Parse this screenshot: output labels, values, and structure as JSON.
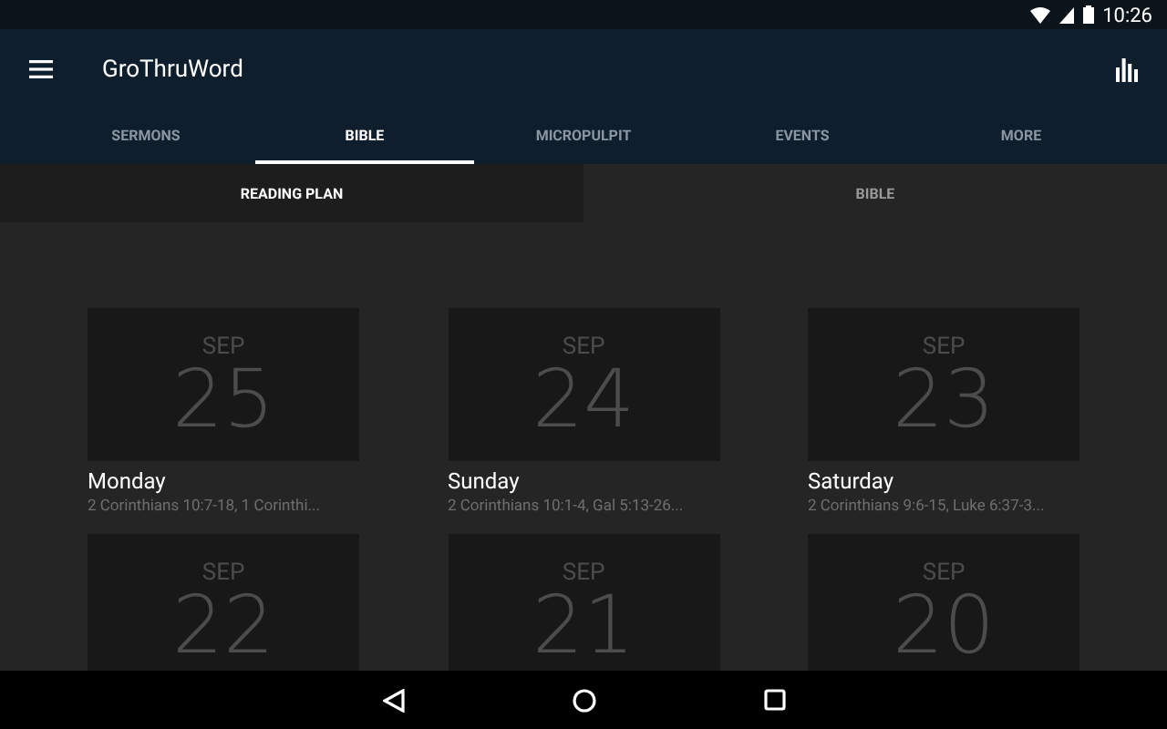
{
  "status_bar": {
    "time": "10:26"
  },
  "app_bar": {
    "title": "GroThruWord"
  },
  "tabs": [
    {
      "label": "SERMONS",
      "selected": false
    },
    {
      "label": "BIBLE",
      "selected": true
    },
    {
      "label": "MICROPULPIT",
      "selected": false
    },
    {
      "label": "EVENTS",
      "selected": false
    },
    {
      "label": "MORE",
      "selected": false
    }
  ],
  "sub_tabs": [
    {
      "label": "READING PLAN",
      "selected": true
    },
    {
      "label": "BIBLE",
      "selected": false
    }
  ],
  "days": [
    {
      "month": "SEP",
      "date": "25",
      "weekday": "Monday",
      "readings": "2 Corinthians 10:7-18, 1 Corinthi..."
    },
    {
      "month": "SEP",
      "date": "24",
      "weekday": "Sunday",
      "readings": "2 Corinthians 10:1-4, Gal 5:13-26..."
    },
    {
      "month": "SEP",
      "date": "23",
      "weekday": "Saturday",
      "readings": "2 Corinthians 9:6-15, Luke 6:37-3..."
    },
    {
      "month": "SEP",
      "date": "22"
    },
    {
      "month": "SEP",
      "date": "21"
    },
    {
      "month": "SEP",
      "date": "20"
    }
  ]
}
